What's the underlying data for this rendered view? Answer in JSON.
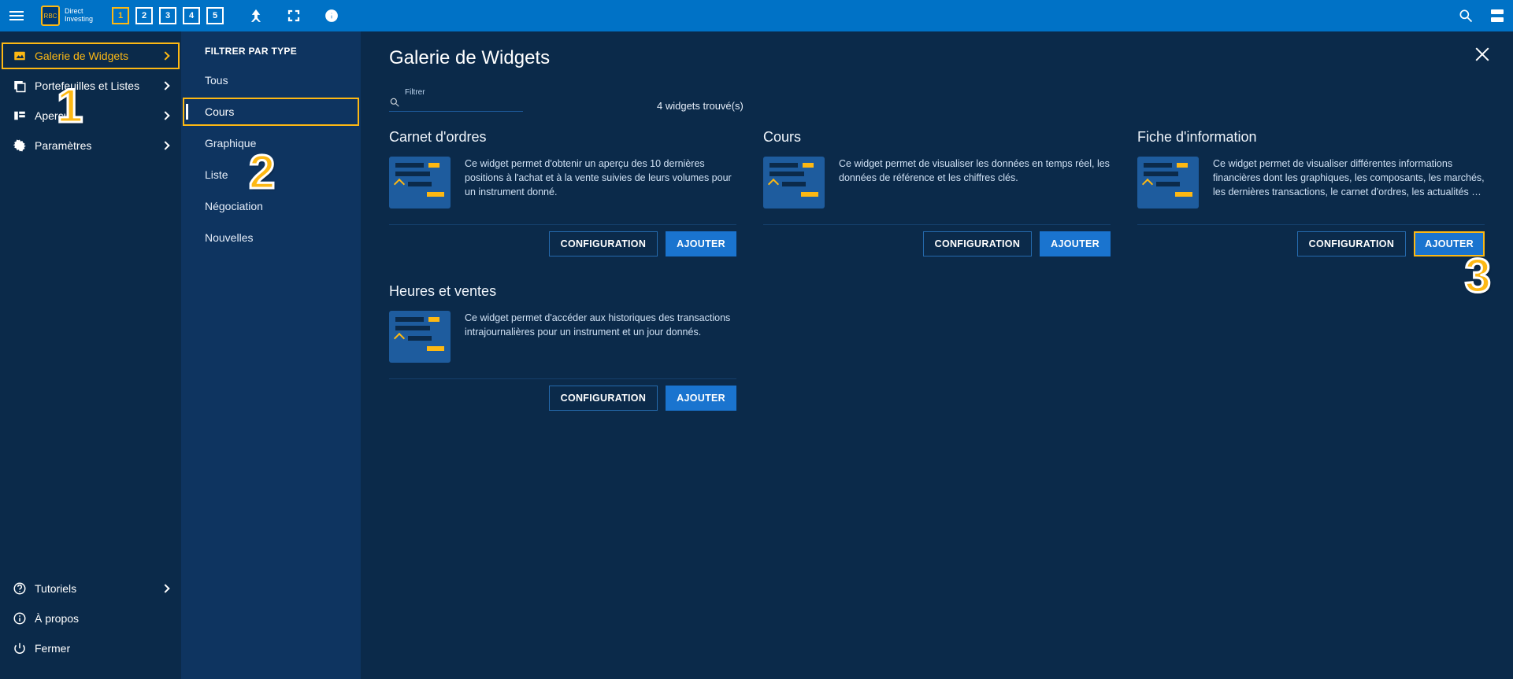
{
  "app": {
    "brand_top": "Direct",
    "brand_bottom": "Investing",
    "brand_sub": "RBC"
  },
  "topbar": {
    "workspaces": [
      "1",
      "2",
      "3",
      "4",
      "5"
    ],
    "active_workspace": 0
  },
  "sidebar": {
    "items": [
      {
        "label": "Galerie de Widgets",
        "name": "sidebar-item-widget-gallery"
      },
      {
        "label": "Portefeuilles et Listes",
        "name": "sidebar-item-portfolios"
      },
      {
        "label": "Aperçus",
        "name": "sidebar-item-overviews"
      },
      {
        "label": "Paramètres",
        "name": "sidebar-item-settings"
      }
    ],
    "bottom": [
      {
        "label": "Tutoriels",
        "name": "sidebar-item-tutorials",
        "chevron": true
      },
      {
        "label": "À propos",
        "name": "sidebar-item-about",
        "chevron": false
      },
      {
        "label": "Fermer",
        "name": "sidebar-item-close",
        "chevron": false
      }
    ]
  },
  "filter": {
    "heading": "FILTRER PAR TYPE",
    "items": [
      "Tous",
      "Cours",
      "Graphique",
      "Liste",
      "Négociation",
      "Nouvelles"
    ],
    "selected": 1
  },
  "main": {
    "title": "Galerie de Widgets",
    "search_label": "Filtrer",
    "search_value": "",
    "count": "4 widgets trouvé(s)",
    "buttons": {
      "config": "CONFIGURATION",
      "add": "AJOUTER"
    },
    "cards": [
      {
        "title": "Carnet d'ordres",
        "desc": "Ce widget permet d'obtenir un aperçu des 10 dernières positions à l'achat et à la vente suivies de leurs volumes pour un instrument donné.",
        "highlight": false
      },
      {
        "title": "Cours",
        "desc": "Ce widget permet de visualiser les données en temps réel, les données de référence et les chiffres clés.",
        "highlight": false
      },
      {
        "title": "Fiche d'information",
        "desc": "Ce widget permet de visualiser différentes informations financières dont les graphiques, les composants, les marchés, les dernières transactions, le carnet d'ordres, les actualités …",
        "highlight": true
      },
      {
        "title": "Heures et ventes",
        "desc": "Ce widget permet d'accéder aux historiques des transactions intrajournalières pour un instrument et un jour donnés.",
        "highlight": false
      }
    ]
  },
  "callouts": {
    "one": "1",
    "two": "2",
    "three": "3"
  }
}
